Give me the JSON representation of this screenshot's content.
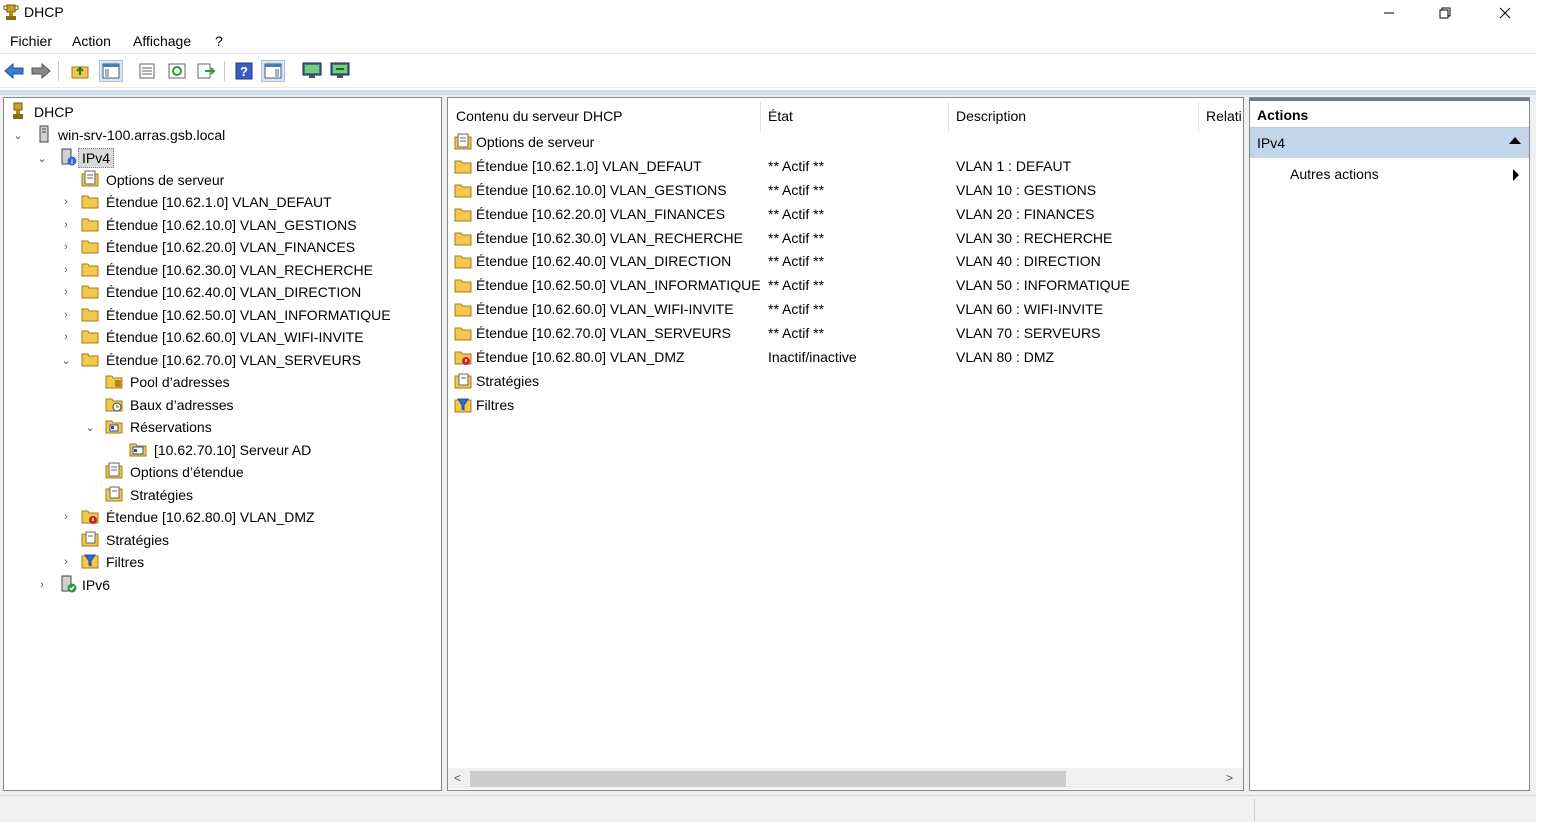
{
  "window": {
    "title": "DHCP",
    "icon": "dhcp-trophy-icon"
  },
  "menu": [
    "Fichier",
    "Action",
    "Affichage",
    "?"
  ],
  "toolbar": {
    "buttons": [
      "back-arrow-icon",
      "forward-arrow-icon",
      "up-folder-icon",
      "show-hide-tree-icon",
      "properties-icon",
      "refresh-icon",
      "export-list-icon",
      "help-icon",
      "show-hide-action-pane-icon",
      "server-monitor-icon",
      "authorize-server-icon"
    ]
  },
  "tree": {
    "root": "DHCP",
    "server": "win-srv-100.arras.gsb.local",
    "ipv4": "IPv4",
    "server_options": "Options de serveur",
    "scopes": [
      "Étendue [10.62.1.0] VLAN_DEFAUT",
      "Étendue [10.62.10.0] VLAN_GESTIONS",
      "Étendue [10.62.20.0] VLAN_FINANCES",
      "Étendue [10.62.30.0] VLAN_RECHERCHE",
      "Étendue [10.62.40.0] VLAN_DIRECTION",
      "Étendue [10.62.50.0] VLAN_INFORMATIQUE",
      "Étendue [10.62.60.0] VLAN_WIFI-INVITE",
      "Étendue [10.62.70.0] VLAN_SERVEURS"
    ],
    "scope70_children": {
      "pool": "Pool d’adresses",
      "leases": "Baux d’adresses",
      "reservations": "Réservations",
      "reservation_item": "[10.62.70.10] Serveur AD",
      "scope_options": "Options d’étendue",
      "policies": "Stratégies"
    },
    "scope_dmz": "Étendue [10.62.80.0] VLAN_DMZ",
    "policies": "Stratégies",
    "filters": "Filtres",
    "ipv6": "IPv6"
  },
  "list": {
    "headers": [
      "Contenu du serveur DHCP",
      "État",
      "Description",
      "Relati"
    ],
    "rows": [
      {
        "name": "Options de serveur",
        "state": "",
        "desc": ""
      },
      {
        "name": "Étendue [10.62.1.0] VLAN_DEFAUT",
        "state": "** Actif **",
        "desc": "VLAN 1 : DEFAUT"
      },
      {
        "name": "Étendue [10.62.10.0] VLAN_GESTIONS",
        "state": "** Actif **",
        "desc": "VLAN 10 : GESTIONS"
      },
      {
        "name": "Étendue [10.62.20.0] VLAN_FINANCES",
        "state": "** Actif **",
        "desc": "VLAN 20 : FINANCES"
      },
      {
        "name": "Étendue [10.62.30.0] VLAN_RECHERCHE",
        "state": "** Actif **",
        "desc": "VLAN 30 : RECHERCHE"
      },
      {
        "name": "Étendue [10.62.40.0] VLAN_DIRECTION",
        "state": "** Actif **",
        "desc": "VLAN 40 : DIRECTION"
      },
      {
        "name": "Étendue [10.62.50.0] VLAN_INFORMATIQUE",
        "state": "** Actif **",
        "desc": "VLAN 50 : INFORMATIQUE"
      },
      {
        "name": "Étendue [10.62.60.0] VLAN_WIFI-INVITE",
        "state": "** Actif **",
        "desc": "VLAN 60 : WIFI-INVITE"
      },
      {
        "name": "Étendue [10.62.70.0] VLAN_SERVEURS",
        "state": "** Actif **",
        "desc": "VLAN 70 : SERVEURS"
      },
      {
        "name": "Étendue [10.62.80.0] VLAN_DMZ",
        "state": "Inactif/inactive",
        "desc": "VLAN 80 : DMZ"
      },
      {
        "name": "Stratégies",
        "state": "",
        "desc": ""
      },
      {
        "name": "Filtres",
        "state": "",
        "desc": ""
      }
    ]
  },
  "actions": {
    "title": "Actions",
    "section": "IPv4",
    "item": "Autres actions"
  },
  "colors": {
    "selection_blue": "#c3d5ea",
    "folder_yellow": "#f2c94c",
    "strip_blue": "#cfdff0"
  }
}
